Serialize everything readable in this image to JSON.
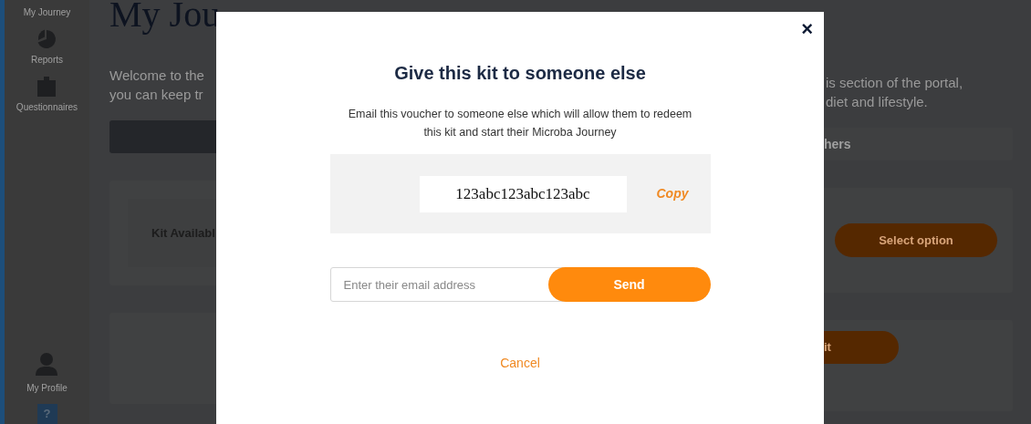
{
  "sidebar": {
    "items": [
      {
        "kind": "text",
        "label": "My Journey"
      },
      {
        "kind": "pie",
        "label": "Reports"
      },
      {
        "kind": "clipboard",
        "label": "Questionnaires"
      }
    ],
    "bottom_items": [
      {
        "kind": "person",
        "label": "My Profile"
      },
      {
        "kind": "help",
        "label": "?"
      }
    ]
  },
  "page": {
    "title": "My Jou",
    "intro_left": [
      "Welcome to the",
      "you can keep tr"
    ],
    "intro_right": [
      "is section of the portal,",
      "diet and lifestyle."
    ],
    "tab_right": "hers",
    "card_label": "Kit Availabl",
    "card_button": "Select option",
    "second_card_button": "it"
  },
  "modal": {
    "close": "×",
    "title": "Give this kit to someone else",
    "description": "Email this voucher to someone else which will allow them to redeem this kit and start their Microba Journey",
    "voucher_code": "123abc123abc123abc",
    "copy": "Copy",
    "email": {
      "placeholder": "Enter their email address"
    },
    "send": "Send",
    "cancel": "Cancel"
  }
}
